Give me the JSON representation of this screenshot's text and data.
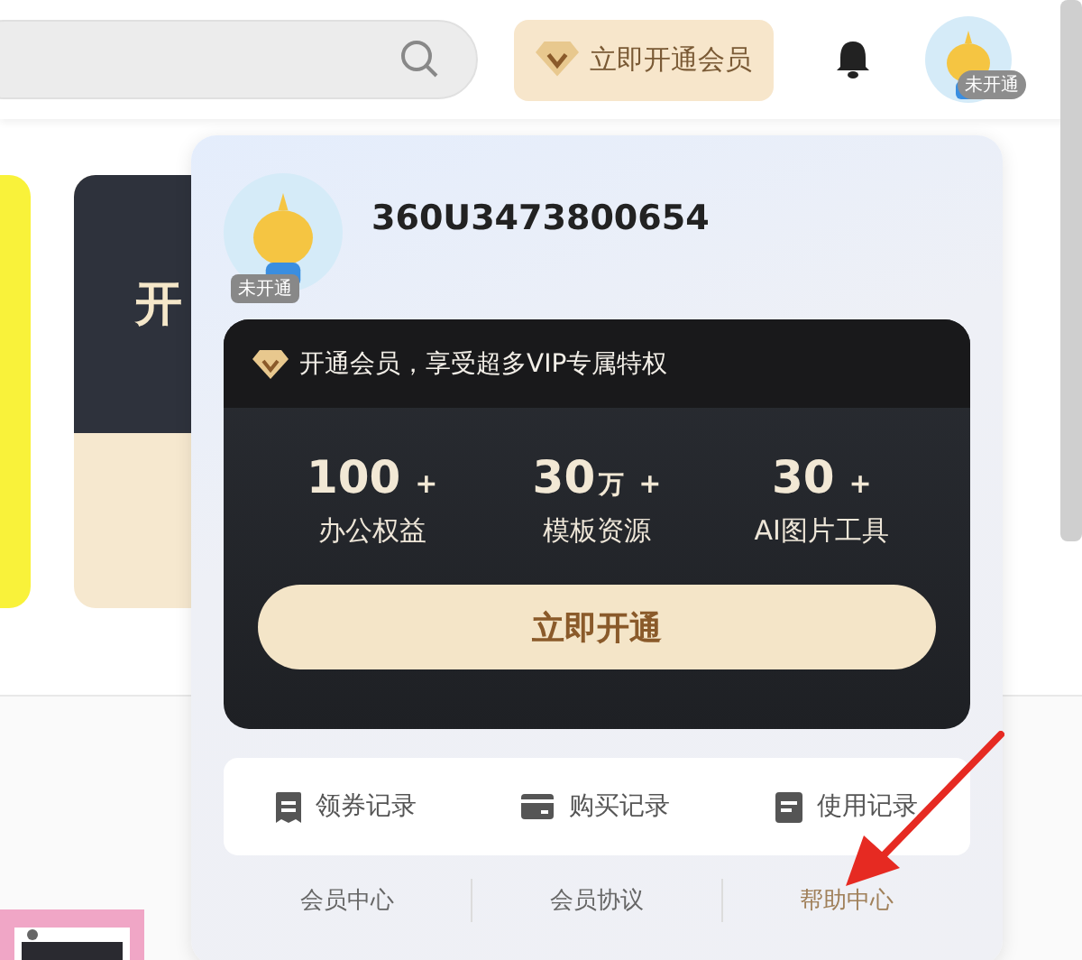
{
  "header": {
    "vip_button": "立即开通会员",
    "avatar_badge": "未开通"
  },
  "promo_card": {
    "title": "开"
  },
  "popup": {
    "username": "360U3473800654",
    "avatar_badge": "未开通",
    "vip_card": {
      "tagline": "开通会员，享受超多VIP专属特权",
      "stats": [
        {
          "value": "100",
          "suffix": "+",
          "label": "办公权益"
        },
        {
          "value": "30",
          "unit": "万",
          "suffix": "+",
          "label": "模板资源"
        },
        {
          "value": "30",
          "suffix": "+",
          "label": "AI图片工具"
        }
      ],
      "button": "立即开通"
    },
    "records": [
      {
        "kind": "ticket",
        "label": "领券记录"
      },
      {
        "kind": "card",
        "label": "购买记录"
      },
      {
        "kind": "doc",
        "label": "使用记录"
      }
    ],
    "links": [
      {
        "label": "会员中心",
        "selected": false
      },
      {
        "label": "会员协议",
        "selected": false
      },
      {
        "label": "帮助中心",
        "selected": true
      }
    ]
  }
}
